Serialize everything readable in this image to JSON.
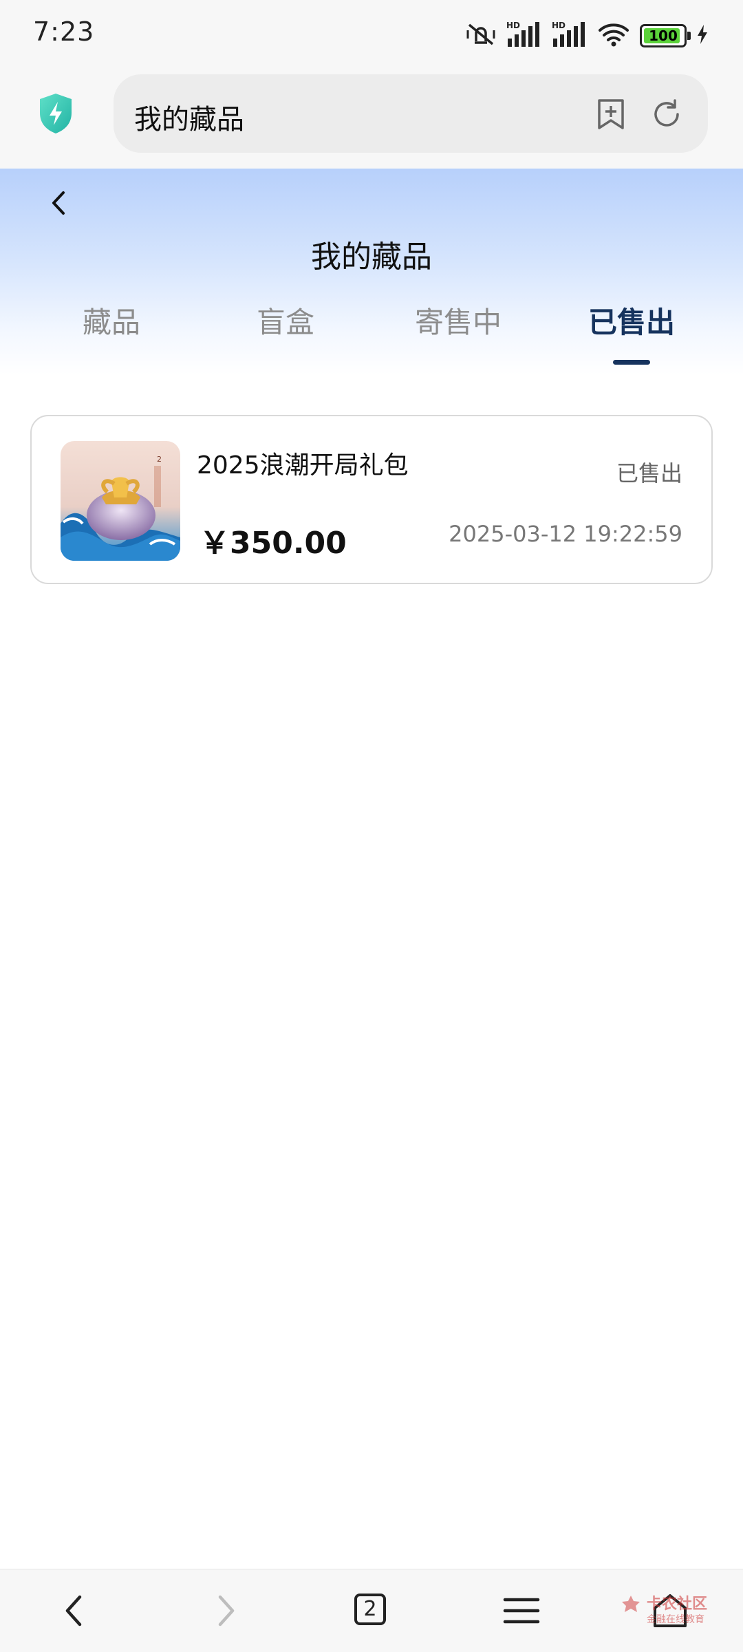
{
  "status_bar": {
    "time": "7:23",
    "hd1": "HD",
    "hd2": "HD",
    "battery": "100"
  },
  "browser": {
    "url_title": "我的藏品",
    "icons": [
      "shield-bolt-icon",
      "bookmark-add-icon",
      "reload-icon"
    ]
  },
  "page": {
    "title": "我的藏品",
    "tabs": [
      {
        "label": "藏品",
        "active": false
      },
      {
        "label": "盲盒",
        "active": false
      },
      {
        "label": "寄售中",
        "active": false
      },
      {
        "label": "已售出",
        "active": true
      }
    ]
  },
  "items": [
    {
      "name": "2025浪潮开局礼包",
      "status": "已售出",
      "price": "￥350.00",
      "time": "2025-03-12 19:22:59"
    }
  ],
  "bottom_nav": {
    "tabs_count": "2",
    "watermark": "卡农社区",
    "watermark_sub": "金融在线教育"
  },
  "colors": {
    "accent": "#16335e",
    "tab_inactive": "#8c8c8c",
    "header_gradient_top": "#b7d0fb"
  }
}
